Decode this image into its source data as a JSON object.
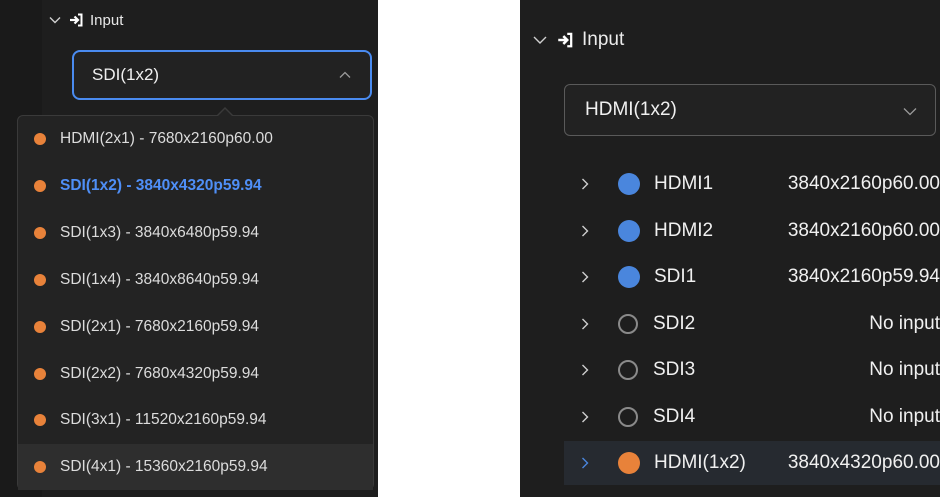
{
  "left": {
    "section_title": "Input",
    "select_value": "SDI(1x2)",
    "dropdown_options": [
      {
        "label": "HDMI(2x1) - 7680x2160p60.00",
        "dot_color": "#e8823a",
        "selected": false,
        "hovered": false
      },
      {
        "label": "SDI(1x2) - 3840x4320p59.94",
        "dot_color": "#e8823a",
        "selected": true,
        "hovered": false
      },
      {
        "label": "SDI(1x3) - 3840x6480p59.94",
        "dot_color": "#e8823a",
        "selected": false,
        "hovered": false
      },
      {
        "label": "SDI(1x4) - 3840x8640p59.94",
        "dot_color": "#e8823a",
        "selected": false,
        "hovered": false
      },
      {
        "label": "SDI(2x1) - 7680x2160p59.94",
        "dot_color": "#e8823a",
        "selected": false,
        "hovered": false
      },
      {
        "label": "SDI(2x2) - 7680x4320p59.94",
        "dot_color": "#e8823a",
        "selected": false,
        "hovered": false
      },
      {
        "label": "SDI(3x1) - 11520x2160p59.94",
        "dot_color": "#e8823a",
        "selected": false,
        "hovered": false
      },
      {
        "label": "SDI(4x1) - 15360x2160p59.94",
        "dot_color": "#e8823a",
        "selected": false,
        "hovered": true
      }
    ]
  },
  "right": {
    "section_title": "Input",
    "select_value": "HDMI(1x2)",
    "sources": [
      {
        "name": "HDMI1",
        "resolution": "3840x2160p60.00",
        "status": "active",
        "dot_color": "#4a86dd"
      },
      {
        "name": "HDMI2",
        "resolution": "3840x2160p60.00",
        "status": "active",
        "dot_color": "#4a86dd"
      },
      {
        "name": "SDI1",
        "resolution": "3840x2160p59.94",
        "status": "active",
        "dot_color": "#4a86dd"
      },
      {
        "name": "SDI2",
        "resolution": "No input",
        "status": "empty",
        "dot_color": "#8a8a8a"
      },
      {
        "name": "SDI3",
        "resolution": "No input",
        "status": "empty",
        "dot_color": "#8a8a8a"
      },
      {
        "name": "SDI4",
        "resolution": "No input",
        "status": "empty",
        "dot_color": "#8a8a8a"
      },
      {
        "name": "HDMI(1x2)",
        "resolution": "3840x4320p60.00",
        "status": "group",
        "dot_color": "#e8823a"
      }
    ]
  },
  "colors": {
    "accent_blue": "#4a8bf0",
    "orange": "#e8823a",
    "panel_bg": "#1e1e1e"
  },
  "icons": [
    "chevron-down-icon",
    "enter-icon",
    "chevron-up-icon",
    "chevron-right-icon"
  ]
}
